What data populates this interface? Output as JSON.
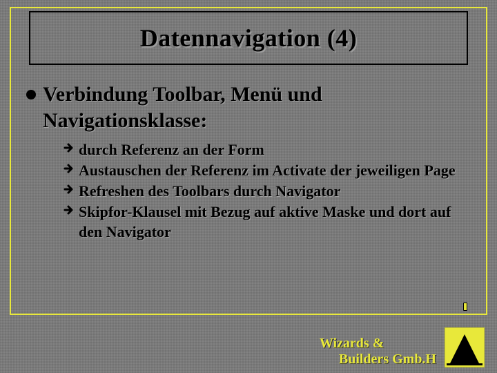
{
  "title": "Datennavigation (4)",
  "heading": "Verbindung Toolbar, Menü und Navigationsklasse:",
  "items": [
    "durch Referenz an der Form",
    "Austauschen der Referenz im Activate der jeweiligen Page",
    "Refreshen des Toolbars durch Navigator",
    "Skipfor-Klausel mit Bezug auf aktive Maske und dort auf den Navigator"
  ],
  "footer": {
    "line1": "Wizards &",
    "line2": "Builders Gmb.H"
  },
  "colors": {
    "accent": "#e8e83a",
    "bg": "#7a7a7a"
  }
}
